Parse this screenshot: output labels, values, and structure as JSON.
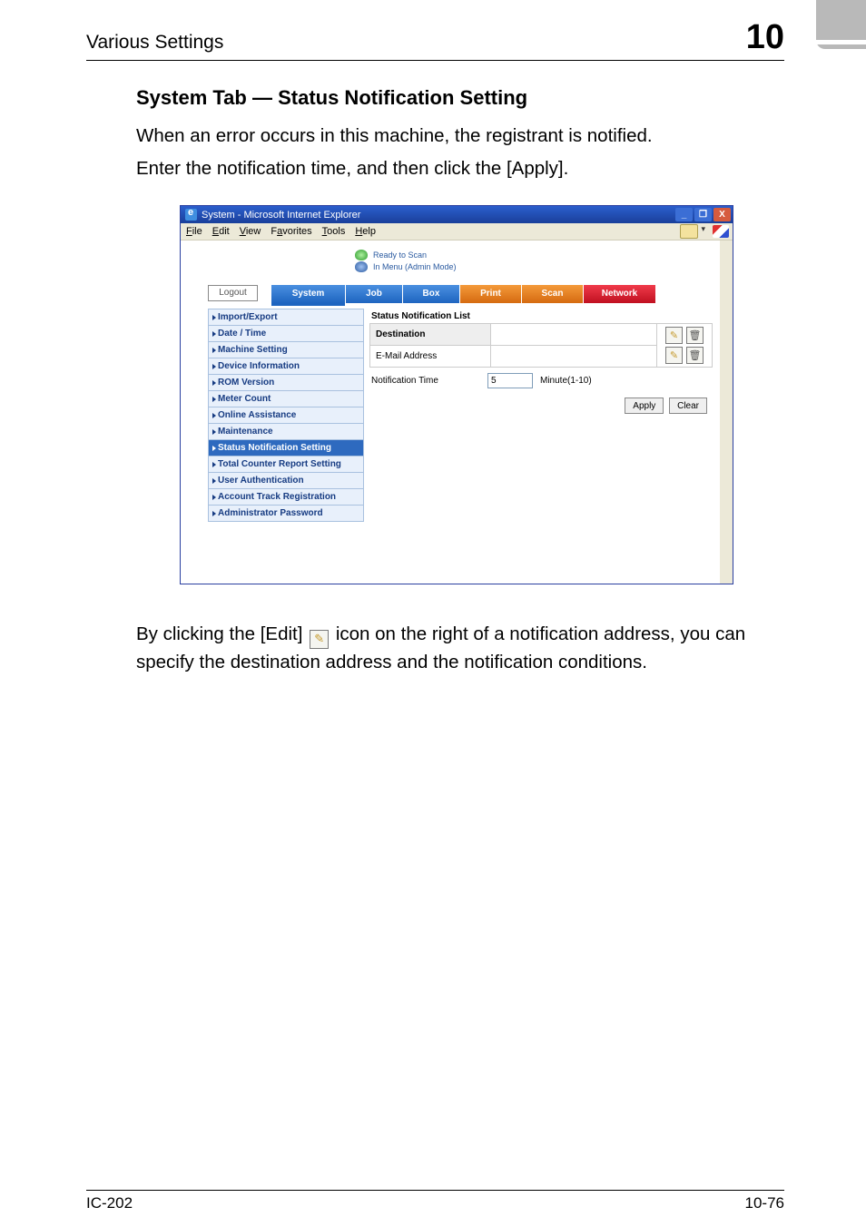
{
  "header": {
    "title": "Various Settings",
    "chapter": "10"
  },
  "section_heading": "System Tab — Status Notification Setting",
  "paragraphs": [
    "When an error occurs in this machine, the registrant is notified.",
    "Enter the notification time, and then click the [Apply]."
  ],
  "after_text_pre": "By clicking the [Edit] ",
  "after_text_post": " icon on the right of a notification address, you can specify the destination address and the notification conditions.",
  "footer": {
    "left": "IC-202",
    "right": "10-76"
  },
  "window": {
    "title": "System - Microsoft Internet Explorer",
    "buttons": {
      "min": "_",
      "max": "❐",
      "close": "X"
    }
  },
  "menu": {
    "file": "File",
    "edit": "Edit",
    "view": "View",
    "favorites": "Favorites",
    "tools": "Tools",
    "help": "Help"
  },
  "status": {
    "line1": "Ready to Scan",
    "line2": "In Menu (Admin Mode)"
  },
  "tabs": {
    "logout": "Logout",
    "system": "System",
    "job": "Job",
    "box": "Box",
    "print": "Print",
    "scan": "Scan",
    "network": "Network"
  },
  "sidebar": {
    "items": [
      {
        "label": "Import/Export"
      },
      {
        "label": "Date / Time"
      },
      {
        "label": "Machine Setting"
      },
      {
        "label": "Device Information"
      },
      {
        "label": "ROM Version"
      },
      {
        "label": "Meter Count"
      },
      {
        "label": "Online Assistance"
      },
      {
        "label": "Maintenance"
      },
      {
        "label": "Status Notification Setting"
      },
      {
        "label": "Total Counter Report Setting"
      },
      {
        "label": "User Authentication"
      },
      {
        "label": "Account Track Registration"
      },
      {
        "label": "Administrator Password"
      }
    ],
    "selected_index": 8
  },
  "mainpane": {
    "title": "Status Notification List",
    "dest_hdr": "Destination",
    "email_lbl": "E-Mail Address",
    "email_val": "",
    "notif_lbl": "Notification Time",
    "notif_val": "5",
    "notif_unit": "Minute(1-10)",
    "apply": "Apply",
    "clear": "Clear",
    "icons": {
      "edit": "✎",
      "del": "🗑"
    }
  }
}
